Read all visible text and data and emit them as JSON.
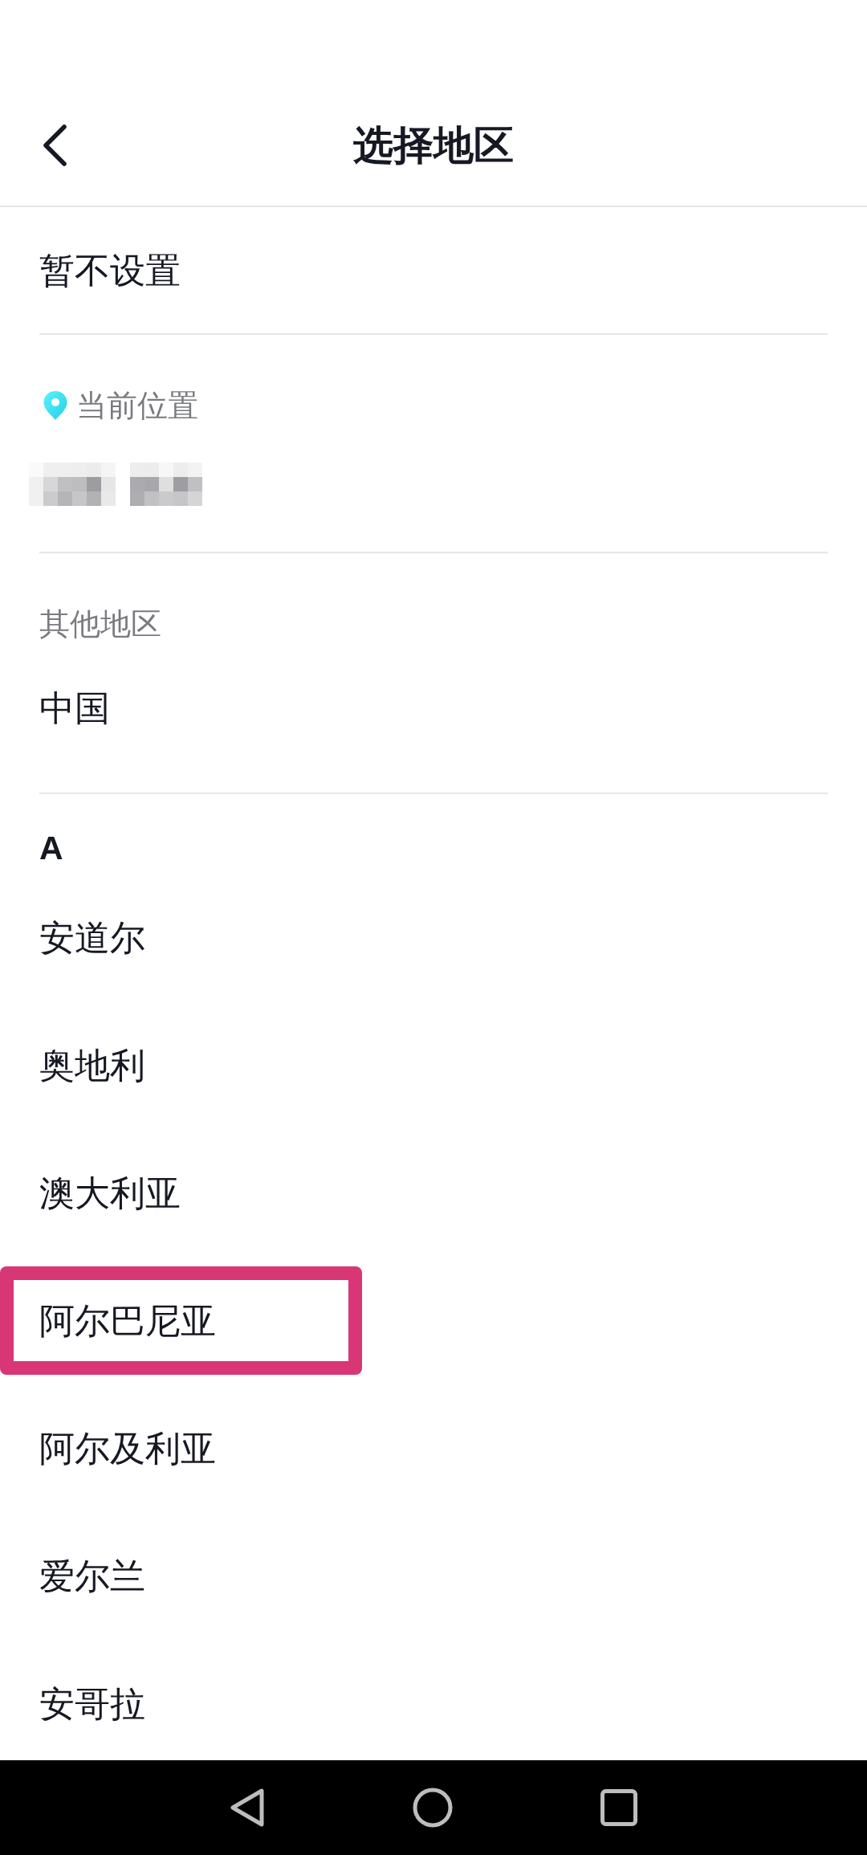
{
  "header": {
    "title": "选择地区"
  },
  "no_setting": {
    "label": "暂不设置"
  },
  "current_location": {
    "label": "当前位置"
  },
  "other_regions": {
    "label": "其他地区",
    "items": [
      {
        "name": "中国"
      }
    ]
  },
  "sections": [
    {
      "letter": "A",
      "regions": [
        {
          "name": "安道尔",
          "highlighted": false
        },
        {
          "name": "奥地利",
          "highlighted": false
        },
        {
          "name": "澳大利亚",
          "highlighted": false
        },
        {
          "name": "阿尔巴尼亚",
          "highlighted": true
        },
        {
          "name": "阿尔及利亚",
          "highlighted": false
        },
        {
          "name": "爱尔兰",
          "highlighted": false
        },
        {
          "name": "安哥拉",
          "highlighted": false
        }
      ]
    }
  ]
}
